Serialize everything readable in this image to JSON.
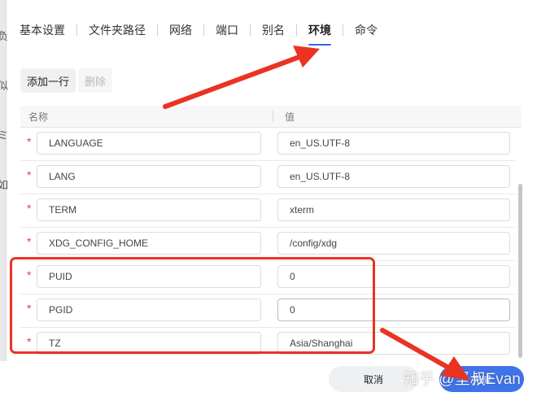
{
  "background": {
    "glyphs": [
      "负",
      "似",
      "ミ",
      "如"
    ]
  },
  "tabs": [
    {
      "label": "基本设置"
    },
    {
      "label": "文件夹路径"
    },
    {
      "label": "网络"
    },
    {
      "label": "端口"
    },
    {
      "label": "别名"
    },
    {
      "label": "环境",
      "active": true
    },
    {
      "label": "命令"
    }
  ],
  "toolbar": {
    "add_label": "添加一行",
    "delete_label": "删除"
  },
  "table": {
    "columns": {
      "name": "名称",
      "value": "值"
    },
    "required_mark": "*",
    "rows": [
      {
        "name": "LANGUAGE",
        "value": "en_US.UTF-8"
      },
      {
        "name": "LANG",
        "value": "en_US.UTF-8"
      },
      {
        "name": "TERM",
        "value": "xterm"
      },
      {
        "name": "XDG_CONFIG_HOME",
        "value": "/config/xdg"
      },
      {
        "name": "PUID",
        "value": "0"
      },
      {
        "name": "PGID",
        "value": "0"
      },
      {
        "name": "TZ",
        "value": "Asia/Shanghai"
      }
    ]
  },
  "footer": {
    "cancel_label": "取消",
    "confirm_label": "完成"
  },
  "watermark": {
    "text": "知乎 @坚叔Evan"
  },
  "colors": {
    "accent": "#3466e6",
    "confirm_button": "#3f73e8",
    "annotation_red": "#ea3323",
    "required_star": "#e0443e"
  }
}
